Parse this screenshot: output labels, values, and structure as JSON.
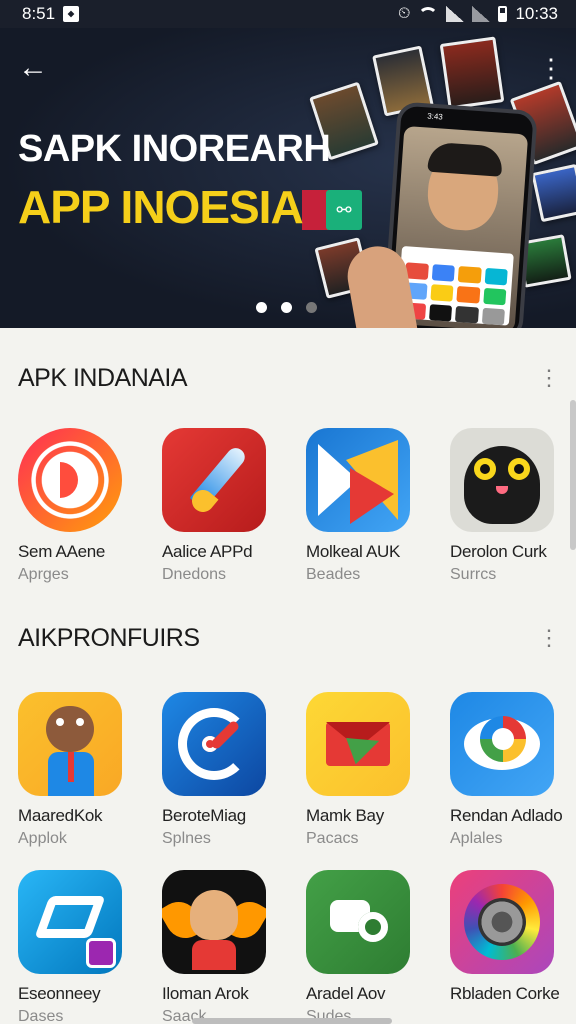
{
  "status_bar": {
    "left_text": "8:51",
    "time": "10:33"
  },
  "hero": {
    "title_line1": "SAPK INOREARH",
    "title_line2": "APP INOESIA",
    "phone_time": "3:43",
    "pagination": {
      "count": 3,
      "active": 1
    }
  },
  "sections": [
    {
      "title": "APK INDANAIA",
      "apps": [
        {
          "name": "Sem AAene",
          "sub": "Aprges",
          "icon": "ring-icon"
        },
        {
          "name": "Aalice APPd",
          "sub": "Dnedons",
          "icon": "rocket-icon"
        },
        {
          "name": "Molkeal AUK",
          "sub": "Beades",
          "icon": "paper-plane-icon"
        },
        {
          "name": "Derolon Curk",
          "sub": "Surrcs",
          "icon": "owl-icon"
        }
      ]
    },
    {
      "title": "AIKPRONFUIRS",
      "apps": [
        {
          "name": "MaaredKok",
          "sub": "Applok",
          "icon": "cartoon-cat-icon"
        },
        {
          "name": "BeroteMiag",
          "sub": "Splnes",
          "icon": "compass-icon"
        },
        {
          "name": "Mamk Bay",
          "sub": "Pacacs",
          "icon": "envelope-icon"
        },
        {
          "name": "Rendan Adlado",
          "sub": "Aplales",
          "icon": "eye-icon"
        }
      ]
    },
    {
      "title": "",
      "apps": [
        {
          "name": "Eseonneey",
          "sub": "Dases",
          "icon": "diamond-icon"
        },
        {
          "name": "Iloman Arok",
          "sub": "Saack",
          "icon": "fox-icon"
        },
        {
          "name": "Aradel Aov",
          "sub": "Sudes",
          "icon": "chat-icon"
        },
        {
          "name": "Rbladen Corke",
          "sub": "",
          "icon": "camera-lens-icon"
        }
      ]
    }
  ],
  "colors": {
    "hero_bg": "#141a27",
    "accent_yellow": "#f5cf1a",
    "page_bg": "#f3f3ef"
  }
}
